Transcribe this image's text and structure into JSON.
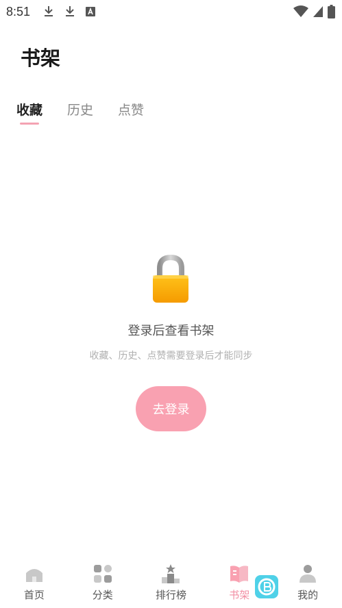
{
  "status_bar": {
    "time": "8:51",
    "icons": [
      "download-icon",
      "download-icon",
      "font-icon",
      "wifi-icon",
      "signal-icon",
      "battery-icon"
    ]
  },
  "header": {
    "title": "书架"
  },
  "tabs": [
    {
      "label": "收藏",
      "active": true
    },
    {
      "label": "历史",
      "active": false
    },
    {
      "label": "点赞",
      "active": false
    }
  ],
  "empty_state": {
    "icon": "lock-icon",
    "title": "登录后查看书架",
    "description": "收藏、历史、点赞需要登录后才能同步",
    "button_label": "去登录"
  },
  "bottom_nav": {
    "items": [
      {
        "label": "首页",
        "icon": "home-icon",
        "active": false
      },
      {
        "label": "分类",
        "icon": "grid-icon",
        "active": false
      },
      {
        "label": "排行榜",
        "icon": "podium-icon",
        "active": false
      },
      {
        "label": "书架",
        "icon": "book-icon",
        "active": true
      },
      {
        "label": "我的",
        "icon": "profile-icon",
        "active": false
      }
    ]
  },
  "colors": {
    "accent": "#f9a1b1",
    "active_tab_text": "#222222",
    "inactive_tab_text": "#888888",
    "nav_active": "#f28ea3"
  }
}
